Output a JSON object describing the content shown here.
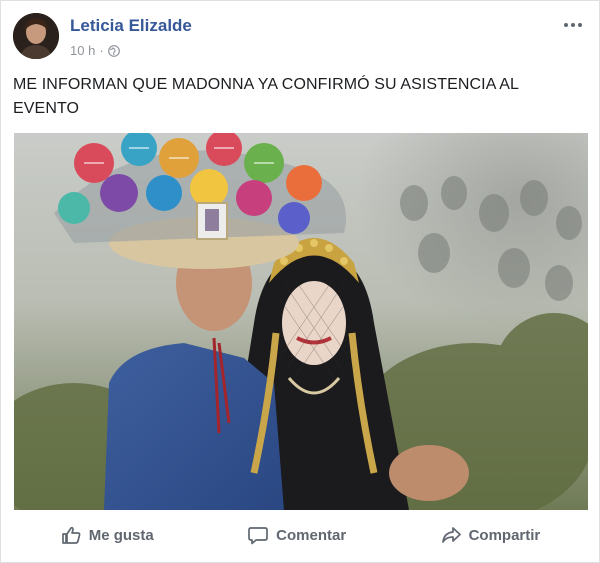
{
  "post": {
    "author": "Leticia Elizalde",
    "time": "10 h",
    "separator": "·",
    "text": "ME INFORMAN QUE MADONNA YA CONFIRMÓ SU ASISTENCIA AL EVENTO",
    "photo": {
      "icons": [
        "floral-headdress",
        "crown",
        "veil"
      ]
    }
  },
  "actions": {
    "like_label": "Me gusta",
    "comment_label": "Comentar",
    "share_label": "Compartir"
  },
  "colors": {
    "author_link": "#365899",
    "secondary_text": "#90949c",
    "action_text": "#606770"
  }
}
